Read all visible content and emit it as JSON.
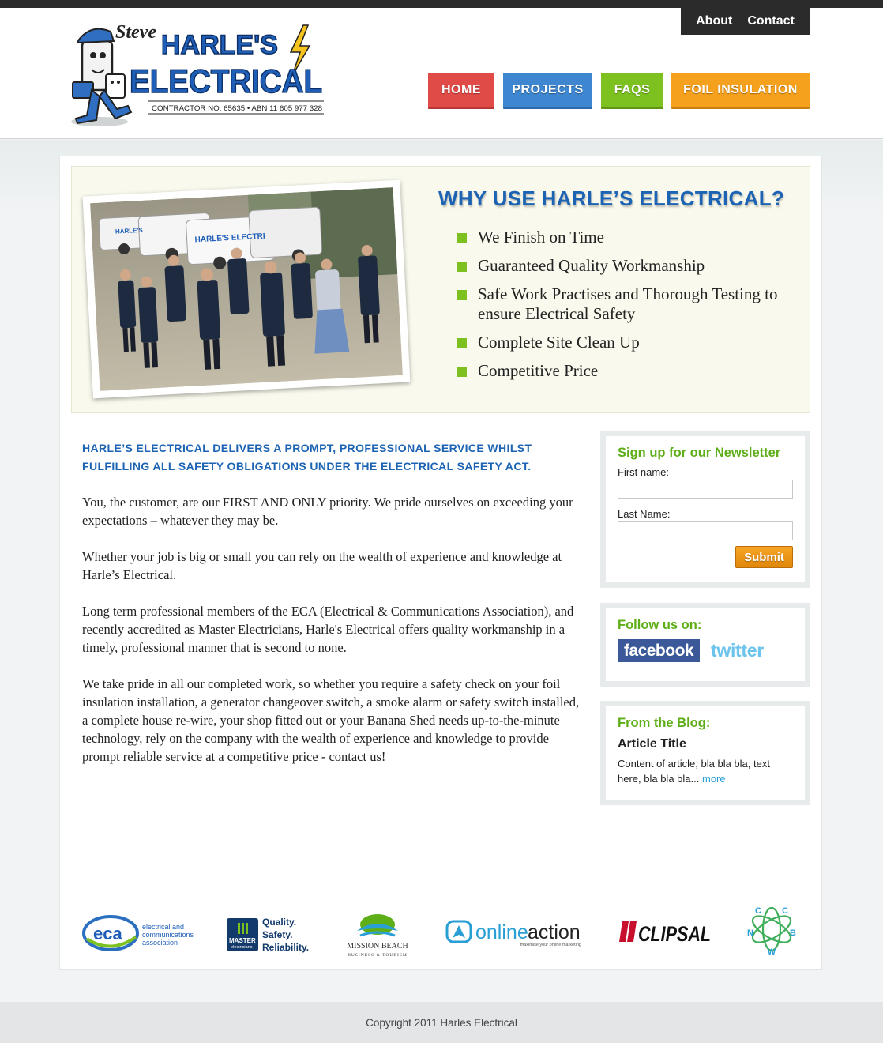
{
  "header": {
    "logo": {
      "name": "Steve",
      "line1": "HARLE'S",
      "line2": "ELECTRICAL",
      "tagline": "CONTRACTOR NO. 65635  •  ABN 11 605 977 328"
    },
    "util_nav": [
      "About",
      "Contact"
    ],
    "main_nav": [
      {
        "label": "HOME",
        "color": "#e04b48"
      },
      {
        "label": "PROJECTS",
        "color": "#3e87d0"
      },
      {
        "label": "FAQS",
        "color": "#7dc121"
      },
      {
        "label": "FOIL INSULATION",
        "color": "#f6a11d"
      }
    ]
  },
  "hero": {
    "photo_text": {
      "van1": "HARLE'S",
      "van2": "HARLE'S ELECTRI"
    },
    "title": "WHY USE HARLE’S ELECTRICAL?",
    "points": [
      "We Finish on Time",
      "Guaranteed Quality Workmanship",
      "Safe Work Practises and Thorough Testing to ensure Electrical Safety",
      "Complete Site Clean Up",
      "Competitive Price"
    ]
  },
  "main": {
    "intro": "HARLE’S ELECTRICAL DELIVERS A PROMPT, PROFESSIONAL SERVICE WHILST FULFILLING ALL SAFETY OBLIGATIONS UNDER THE ELECTRICAL SAFETY ACT.",
    "paragraphs": [
      "You, the customer, are our FIRST AND ONLY priority. We pride ourselves on exceeding your expectations – whatever they may be.",
      "Whether your job is big or small you can rely on the wealth of experience and knowledge at Harle’s Electrical.",
      "Long term professional members of the ECA (Electrical & Communications Association), and recently accredited as Master Electricians, Harle's Electrical offers quality workmanship in a timely, professional manner that is second to none.",
      "We take pride in all our completed work, so whether you require a safety check on your foil insulation installation, a generator changeover switch, a smoke alarm or safety switch installed, a complete house re-wire, your shop fitted out or your Banana Shed needs up-to-the-minute technology, rely on the company with the wealth of experience and knowledge to provide prompt reliable service at a competitive price - contact us!"
    ]
  },
  "newsletter": {
    "title": "Sign up for our Newsletter",
    "first_name_label": "First name:",
    "last_name_label": "Last Name:",
    "first_name_value": "",
    "last_name_value": "",
    "submit_label": "Submit"
  },
  "follow": {
    "title": "Follow us on:",
    "facebook": "facebook",
    "twitter": "twitter"
  },
  "blog": {
    "title": "From the Blog:",
    "article_title": "Article Title",
    "excerpt": "Content of article, bla bla bla, text here, bla bla bla...",
    "more": "more"
  },
  "partners": {
    "eca": {
      "mark": "eca",
      "text": [
        "electrical and",
        "communications",
        "association"
      ]
    },
    "master": {
      "badge": "MASTER",
      "badge_sub": "electricians",
      "text": [
        "Quality.",
        "Safety.",
        "Reliability."
      ]
    },
    "mission": {
      "line1": "MISSION BEACH",
      "line2": "BUSINESS & TOURISM"
    },
    "onlineaction": {
      "online": "online",
      "action": "action",
      "tagline": "maximise your online marketing"
    },
    "clipsal": "CLIPSAL",
    "ccnwb": [
      "C",
      "C",
      "N",
      "B",
      "W"
    ]
  },
  "footer": {
    "copyright": "Copyright 2011 Harles Electrical"
  }
}
